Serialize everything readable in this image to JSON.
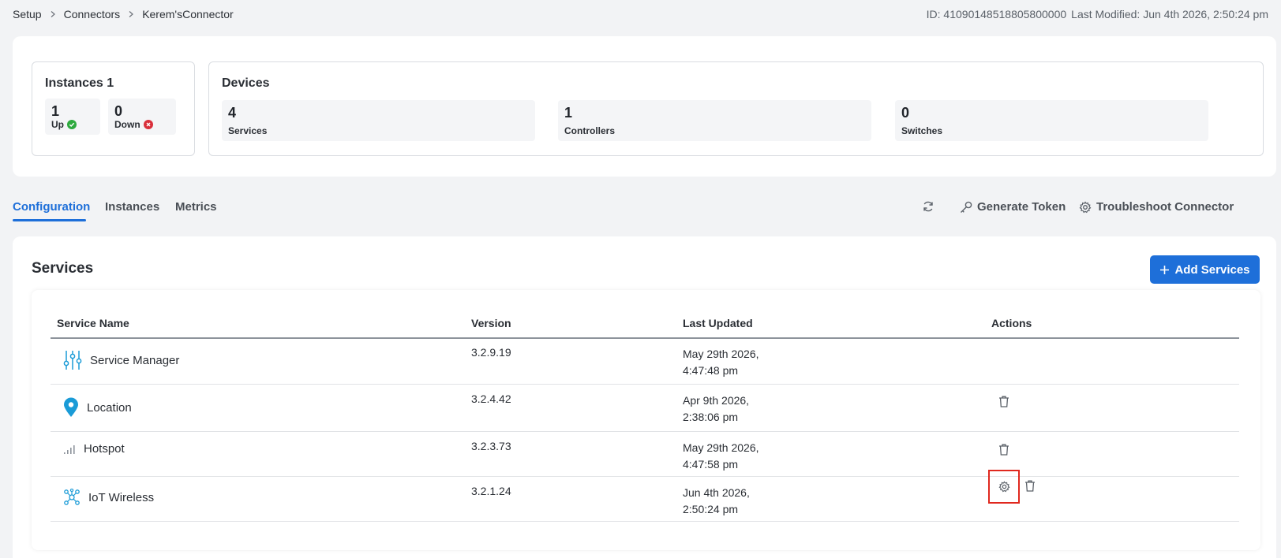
{
  "breadcrumb": [
    "Setup",
    "Connectors",
    "Kerem'sConnector"
  ],
  "meta": {
    "id": "ID: 41090148518805800000",
    "modified": "Last Modified: Jun 4th 2026, 2:50:24 pm"
  },
  "instances": {
    "title": "Instances 1",
    "up": {
      "value": "1",
      "label": "Up"
    },
    "down": {
      "value": "0",
      "label": "Down"
    }
  },
  "devices": {
    "title": "Devices",
    "stats": [
      {
        "value": "4",
        "label": "Services"
      },
      {
        "value": "1",
        "label": "Controllers"
      },
      {
        "value": "0",
        "label": "Switches"
      }
    ]
  },
  "tabs": [
    "Configuration",
    "Instances",
    "Metrics"
  ],
  "tools": {
    "generate_token": "Generate Token",
    "troubleshoot": "Troubleshoot Connector"
  },
  "services": {
    "title": "Services",
    "add_label": "Add Services",
    "columns": [
      "Service Name",
      "Version",
      "Last Updated",
      "Actions"
    ],
    "rows": [
      {
        "name": "Service Manager",
        "icon": "sliders-icon",
        "version": "3.2.9.19",
        "date1": "May 29th 2026,",
        "date2": "4:47:48 pm"
      },
      {
        "name": "Location",
        "icon": "location-pin-icon",
        "version": "3.2.4.42",
        "date1": "Apr 9th 2026,",
        "date2": "2:38:06 pm"
      },
      {
        "name": "Hotspot",
        "icon": "signal-bars-icon",
        "version": "3.2.3.73",
        "date1": "May 29th 2026,",
        "date2": "4:47:58 pm"
      },
      {
        "name": "IoT Wireless",
        "icon": "network-nodes-icon",
        "version": "3.2.1.24",
        "date1": "Jun 4th 2026,",
        "date2": "2:50:24 pm"
      }
    ]
  },
  "colors": {
    "accent": "#1e6fd9",
    "up": "#2eaa3f",
    "down": "#d9303b",
    "highlight": "#e0281e"
  }
}
